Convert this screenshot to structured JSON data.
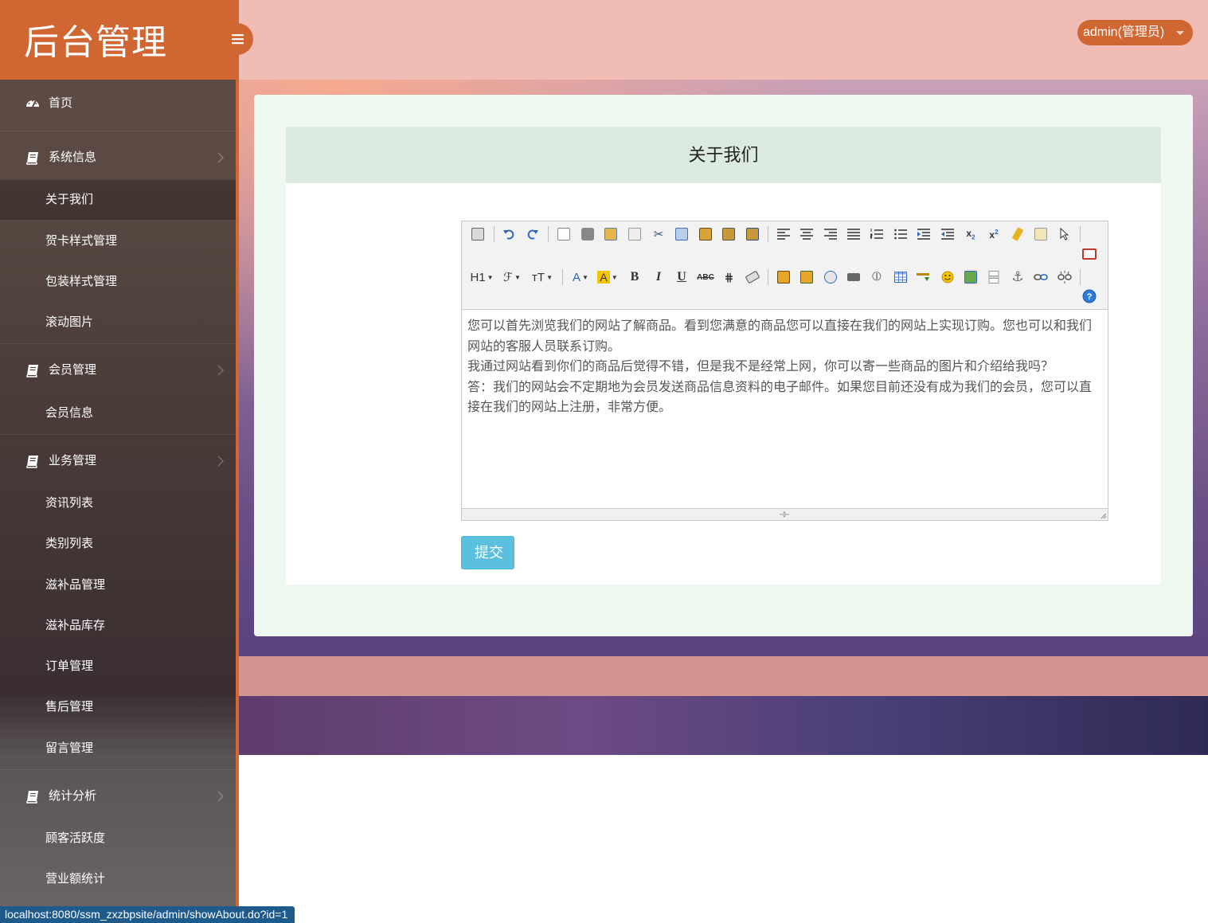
{
  "brand": {
    "title": "后台管理"
  },
  "header": {
    "user": "admin(管理员)"
  },
  "sidebar": {
    "home": "首页",
    "groups": [
      {
        "label": "系统信息",
        "items": [
          "关于我们",
          "贺卡样式管理",
          "包装样式管理",
          "滚动图片"
        ]
      },
      {
        "label": "会员管理",
        "items": [
          "会员信息"
        ]
      },
      {
        "label": "业务管理",
        "items": [
          "资讯列表",
          "类别列表",
          "滋补品管理",
          "滋补品库存",
          "订单管理",
          "售后管理",
          "留言管理"
        ]
      },
      {
        "label": "统计分析",
        "items": [
          "顾客活跃度",
          "营业额统计"
        ]
      }
    ],
    "active_item": "关于我们"
  },
  "panel": {
    "title": "关于我们"
  },
  "editor": {
    "toolbar_row2_labels": {
      "heading": "H1",
      "font_family": "ℱ",
      "font_size": "тT"
    },
    "paragraphs": [
      "您可以首先浏览我们的网站了解商品。看到您满意的商品您可以直接在我们的网站上实现订购。您也可以和我们网站的客服人员联系订购。",
      "我通过网站看到你们的商品后觉得不错，但是我不是经常上网，你可以寄一些商品的图片和介绍给我吗？",
      "答：我们的网站会不定期地为会员发送商品信息资料的电子邮件。如果您目前还没有成为我们的会员，您可以直接在我们的网站上注册，非常方便。"
    ]
  },
  "submit_label": "提交",
  "status_bar": {
    "url": "localhost:8080/ssm_zxzbpsite/admin/showAbout.do?id=1"
  },
  "colors": {
    "brand": "#d06732",
    "header": "#f0bcb4",
    "submit": "#5bc0de",
    "panel_head": "#dcebdf"
  }
}
